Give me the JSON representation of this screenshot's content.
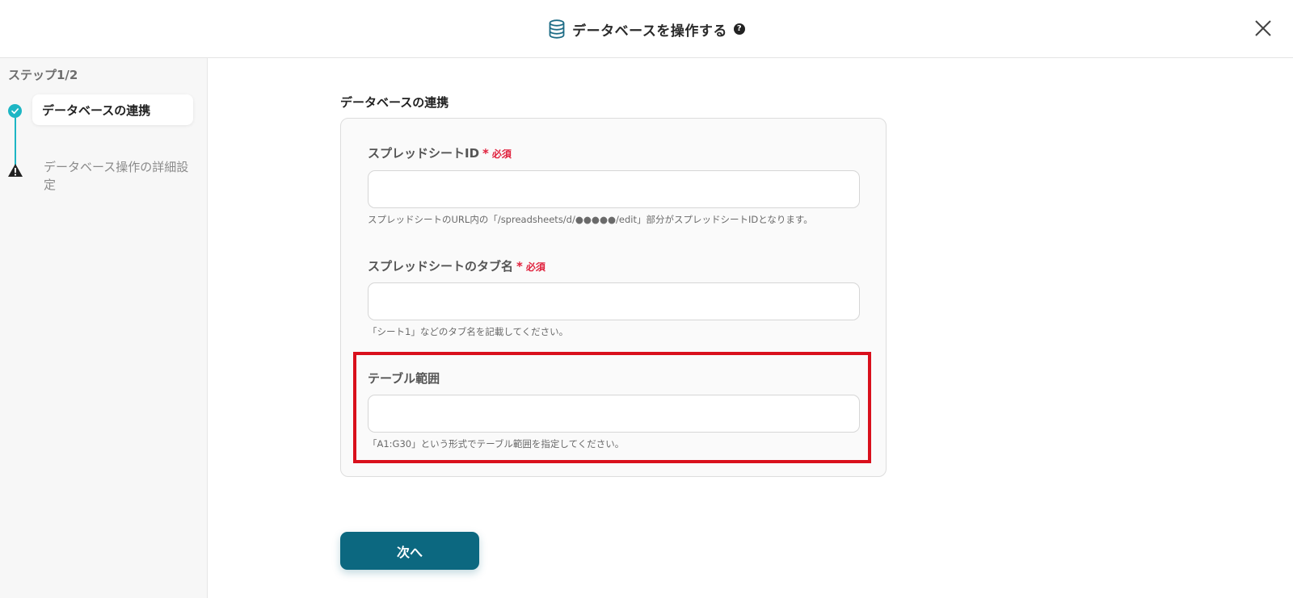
{
  "header": {
    "title": "データベースを操作する",
    "help_symbol": "?",
    "icon": "database-icon",
    "close_icon": "close-icon"
  },
  "sidebar": {
    "step_label": "ステップ1/2",
    "steps": [
      {
        "label": "データベースの連携",
        "status": "complete",
        "icon": "check-circle-icon"
      },
      {
        "label": "データベース操作の詳細設定",
        "status": "warning",
        "icon": "warning-icon"
      }
    ]
  },
  "main": {
    "section_title": "データベースの連携",
    "fields": [
      {
        "label": "スプレッドシートID",
        "required_star": "*",
        "required_text": "必須",
        "value": "",
        "hint": "スプレッドシートのURL内の「/spreadsheets/d/●●●●●/edit」部分がスプレッドシートIDとなります。"
      },
      {
        "label": "スプレッドシートのタブ名",
        "required_star": "*",
        "required_text": "必須",
        "value": "",
        "hint": "「シート1」などのタブ名を記載してください。"
      },
      {
        "label": "テーブル範囲",
        "value": "",
        "hint": "「A1:G30」という形式でテーブル範囲を指定してください。"
      }
    ],
    "next_button": "次へ"
  },
  "colors": {
    "accent": "#1db6c4",
    "primary_button": "#0c6880",
    "required": "#e0203c",
    "highlight": "#d9101c"
  }
}
